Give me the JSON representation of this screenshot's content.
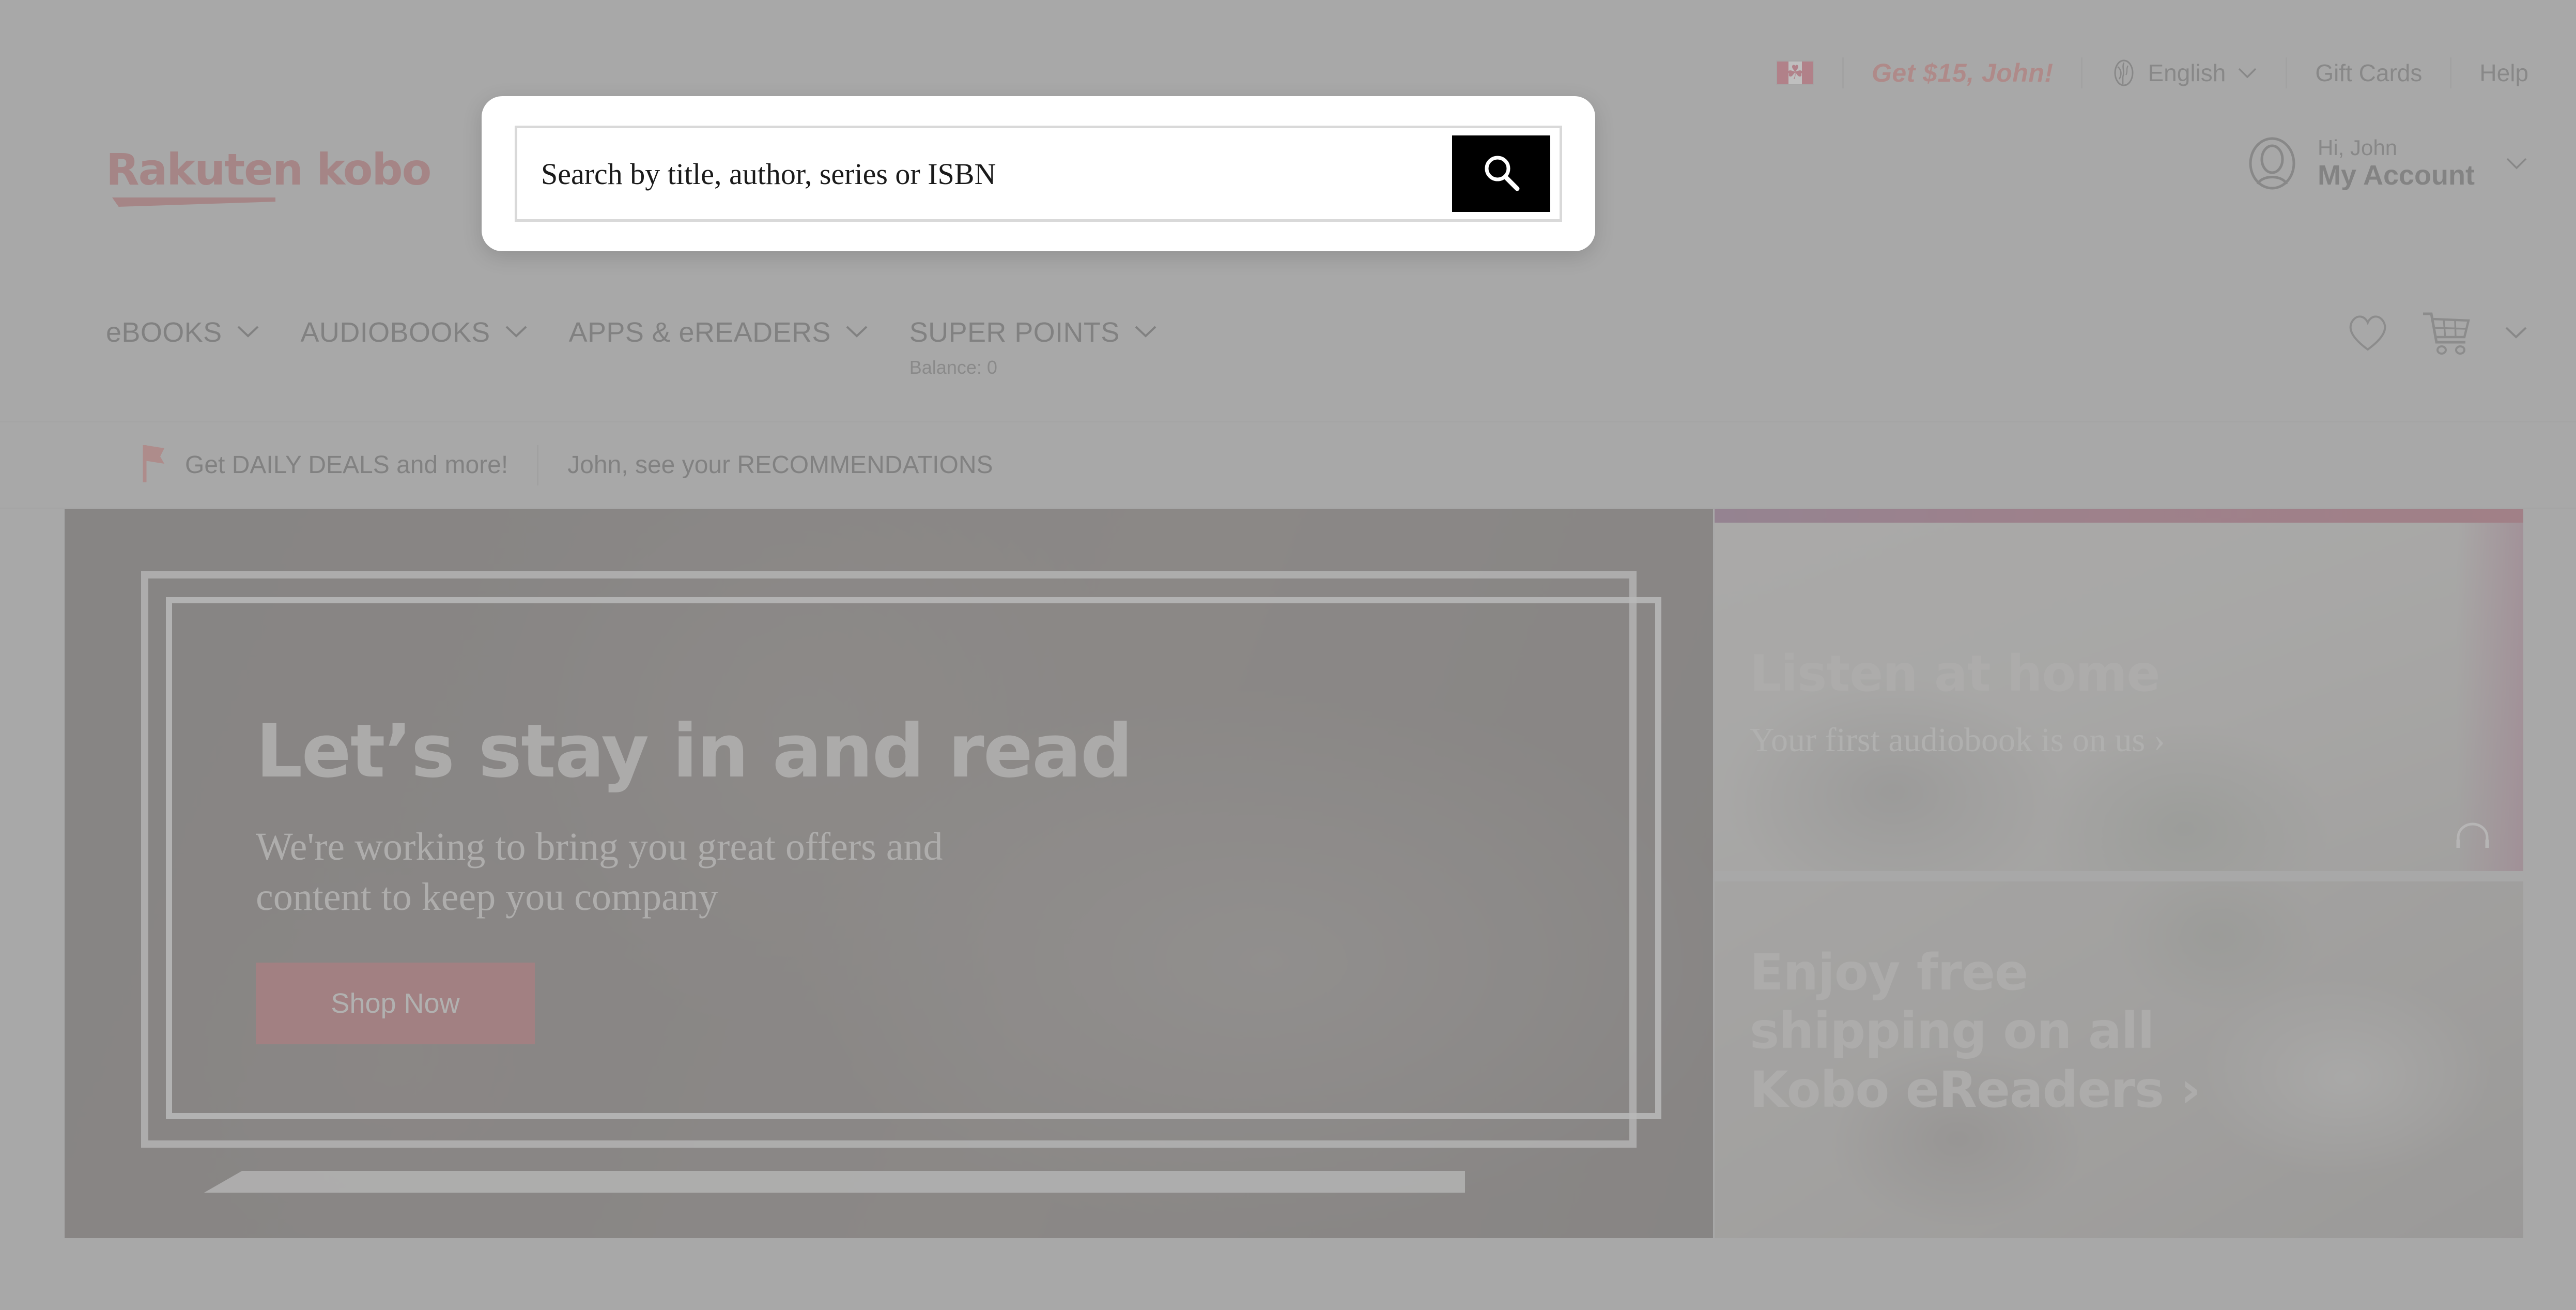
{
  "brand": {
    "logo_text": "Rakuten kobo",
    "accent_red": "#9b2226",
    "promo_red": "#c1352f",
    "cta_red": "#8f0f16"
  },
  "utility_bar": {
    "flag_icon": "canada-flag-icon",
    "flag_leaf": "☘",
    "promo_offer": "Get $15, John!",
    "language_icon": "globe-icon",
    "language": "English",
    "language_caret": "chevron-down-icon",
    "gift_cards": "Gift Cards",
    "help": "Help"
  },
  "account": {
    "avatar_icon": "user-avatar-icon",
    "greeting": "Hi, John",
    "label": "My Account",
    "caret": "chevron-down-icon"
  },
  "search": {
    "placeholder": "Search by title, author, series or ISBN",
    "value": "",
    "button_icon": "search-icon"
  },
  "main_nav": {
    "items": [
      {
        "label": "eBOOKS",
        "caret": "chevron-down-icon",
        "sub": ""
      },
      {
        "label": "AUDIOBOOKS",
        "caret": "chevron-down-icon",
        "sub": ""
      },
      {
        "label": "APPS & eREADERS",
        "caret": "chevron-down-icon",
        "sub": ""
      },
      {
        "label": "SUPER POINTS",
        "caret": "chevron-down-icon",
        "sub": "Balance: 0"
      }
    ],
    "wishlist_icon": "heart-icon",
    "cart_icon": "shopping-cart-icon",
    "cart_caret": "chevron-down-icon"
  },
  "promo_strip": {
    "flag_icon": "red-flag-icon",
    "deals_link": "Get DAILY DEALS and more!",
    "recommendations_link": "John, see your RECOMMENDATIONS"
  },
  "hero": {
    "title": "Let’s stay in and read",
    "subtitle": "We're working to bring you great offers and content to keep you company",
    "cta": "Shop Now"
  },
  "cards": [
    {
      "heading": "Listen at home",
      "subtext": "Your first audiobook is on us ›",
      "icon": "headphones-icon",
      "gradient_from": "#5c1a4e",
      "gradient_to": "#8b0f27"
    },
    {
      "heading": "Enjoy free shipping on all Kobo eReaders ›",
      "subtext": "",
      "icon": "",
      "gradient_from": "",
      "gradient_to": ""
    }
  ]
}
